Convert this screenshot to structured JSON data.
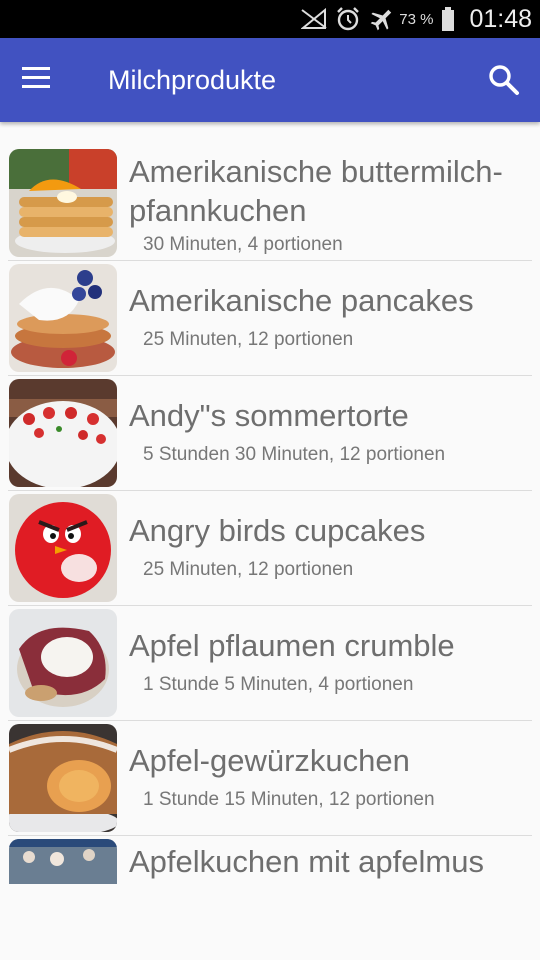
{
  "status_bar": {
    "battery_percent": "73 %",
    "time": "01:48",
    "icons": [
      "no-signal-icon",
      "alarm-icon",
      "airplane-icon",
      "battery-icon"
    ]
  },
  "app_bar": {
    "title": "Milchprodukte",
    "menu_icon": "menu-icon",
    "search_icon": "search-icon"
  },
  "recipes": [
    {
      "name": "Amerikanische buttermilch-pfannkuchen",
      "meta": "30 Minuten, 4 portionen"
    },
    {
      "name": "Amerikanische pancakes",
      "meta": "25 Minuten, 12 portionen"
    },
    {
      "name": "Andy\"s sommertorte",
      "meta": "5 Stunden 30 Minuten, 12 portionen"
    },
    {
      "name": "Angry birds cupcakes",
      "meta": "25 Minuten, 12 portionen"
    },
    {
      "name": "Apfel pflaumen crumble",
      "meta": "1 Stunde 5 Minuten, 4 portionen"
    },
    {
      "name": "Apfel-gewürzkuchen",
      "meta": "1 Stunde 15 Minuten, 12 portionen"
    },
    {
      "name": "Apfelkuchen mit apfelmus",
      "meta": ""
    }
  ]
}
